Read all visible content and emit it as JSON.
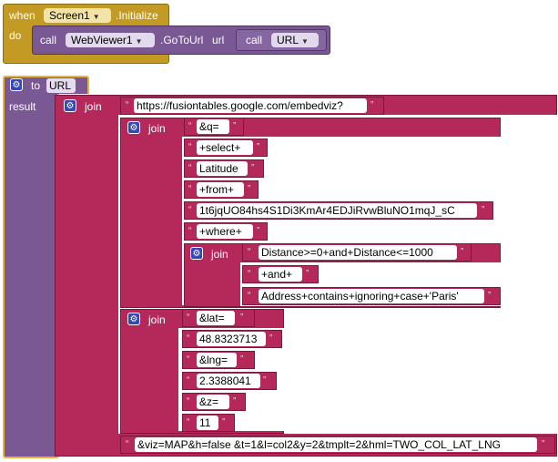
{
  "event_block": {
    "when": "when",
    "component": "Screen1",
    "event": ".Initialize",
    "do": "do"
  },
  "call_block": {
    "call": "call",
    "component": "WebViewer1",
    "method": ".GoToUrl",
    "param": "url",
    "inner_call": "call",
    "procedure": "URL"
  },
  "proc_block": {
    "to": "to",
    "name": "URL",
    "result": "result"
  },
  "join_label": "join",
  "quote": "“",
  "endquote": "”",
  "strings": {
    "base_url": "https://fusiontables.google.com/embedviz?",
    "q": "&q=",
    "select": "+select+",
    "latitude": "Latitude",
    "from": "+from+",
    "table_id": "1t6jqUO84hs4S1Di3KmAr4EDJiRvwBluNO1mqJ_sC",
    "where": "+where+",
    "distance": "Distance>=0+and+Distance<=1000",
    "and": "+and+",
    "address": "Address+contains+ignoring+case+'Paris'",
    "lat": "&lat=",
    "lat_val": "48.8323713",
    "lng": "&lng=",
    "lng_val": "2.3388041",
    "z": "&z=",
    "z_val": "11",
    "viz": "&viz=MAP&h=false &t=1&l=col2&y=2&tmplt=2&hml=TWO_COL_LAT_LNG"
  },
  "colors": {
    "control": "#c29a24",
    "procedure": "#7a5894",
    "text": "#b5285a",
    "mutator": "#3348b5"
  },
  "icons": {
    "gear": "gear-icon",
    "dropdown": "chevron-down-icon"
  }
}
